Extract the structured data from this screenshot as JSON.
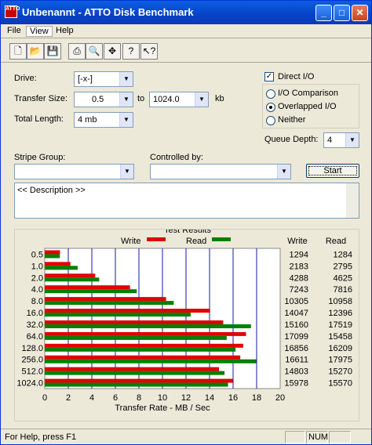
{
  "window": {
    "title": "Unbenannt - ATTO Disk Benchmark",
    "app_icon_text": "ATTO"
  },
  "menu": [
    "File",
    "View",
    "Help"
  ],
  "toolbar_icons": [
    "new-icon",
    "open-icon",
    "save-icon",
    "print-icon",
    "print-preview-icon",
    "move-icon",
    "help-icon",
    "context-help-icon"
  ],
  "form": {
    "drive_label": "Drive:",
    "drive_value": "[-x-]",
    "transfer_size_label": "Transfer Size:",
    "transfer_from": "0.5",
    "transfer_to_label": "to",
    "transfer_to": "1024.0",
    "transfer_unit": "kb",
    "total_length_label": "Total Length:",
    "total_length_value": "4 mb",
    "direct_io_label": "Direct I/O",
    "direct_io_checked": true,
    "io_comparison_label": "I/O Comparison",
    "overlapped_io_label": "Overlapped I/O",
    "neither_label": "Neither",
    "selected_io": "Overlapped I/O",
    "queue_depth_label": "Queue Depth:",
    "queue_depth_value": "4",
    "stripe_group_label": "Stripe Group:",
    "stripe_group_value": "",
    "controlled_by_label": "Controlled by:",
    "controlled_by_value": "",
    "start_label": "Start",
    "description": "<< Description >>"
  },
  "results": {
    "title": "Test Results",
    "legend_write": "Write",
    "legend_read": "Read",
    "col_write": "Write",
    "col_read": "Read",
    "write_color": "#e00000",
    "read_color": "#008000"
  },
  "chart_data": {
    "type": "bar",
    "xlabel": "Transfer Rate - MB / Sec",
    "xlim": [
      0,
      20
    ],
    "xticks": [
      0,
      2,
      4,
      6,
      8,
      10,
      12,
      14,
      16,
      18,
      20
    ],
    "categories": [
      "0.5",
      "1.0",
      "2.0",
      "4.0",
      "8.0",
      "16.0",
      "32.0",
      "64.0",
      "128.0",
      "256.0",
      "512.0",
      "1024.0"
    ],
    "series": [
      {
        "name": "Write",
        "values": [
          1294,
          2183,
          4288,
          7243,
          10305,
          14047,
          15160,
          17099,
          16856,
          16611,
          14803,
          15978
        ]
      },
      {
        "name": "Read",
        "values": [
          1284,
          2795,
          4625,
          7816,
          10958,
          12396,
          17519,
          15458,
          16209,
          17975,
          15270,
          15570
        ]
      }
    ]
  },
  "status": {
    "text": "For Help, press F1",
    "num": "NUM"
  }
}
